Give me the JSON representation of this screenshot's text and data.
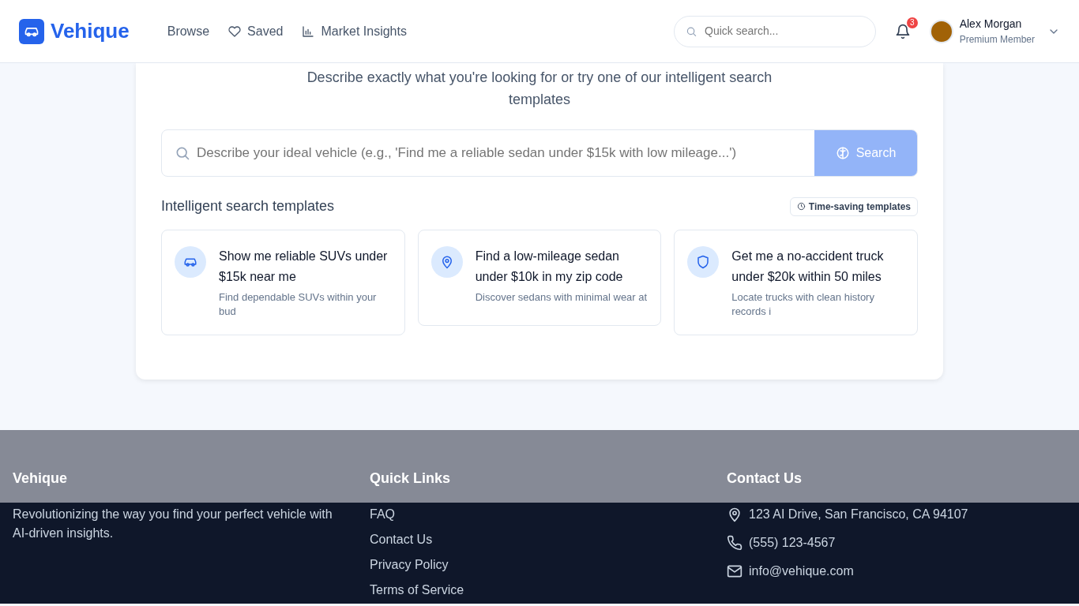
{
  "header": {
    "brand": "Vehique",
    "nav": [
      {
        "label": "Browse"
      },
      {
        "label": "Saved"
      },
      {
        "label": "Market Insights"
      }
    ],
    "search": {
      "placeholder": "Quick search..."
    },
    "notifications": {
      "count": "3"
    },
    "user": {
      "name": "Alex Morgan",
      "role": "Premium Member"
    }
  },
  "hero": {
    "subtitle": "Describe exactly what you're looking for or try one of our intelligent search templates",
    "search": {
      "placeholder": "Describe your ideal vehicle (e.g., 'Find me a reliable sedan under $15k with low mileage...')",
      "button": "Search",
      "disabled": true
    }
  },
  "templates": {
    "title": "Intelligent search templates",
    "tag": "Time-saving templates",
    "items": [
      {
        "title": "Show me reliable SUVs under $15k near me",
        "description": "Find dependable SUVs within your bud"
      },
      {
        "title": "Find a low-mileage sedan under $10k in my zip code",
        "description": "Discover sedans with minimal wear at"
      },
      {
        "title": "Get me a no-accident truck under $20k within 50 miles",
        "description": "Locate trucks with clean history records i"
      }
    ]
  },
  "footer": {
    "columns": [
      {
        "kind": "about",
        "title": "Vehique",
        "text": "Revolutionizing the way you find your perfect vehicle with AI-driven insights."
      },
      {
        "kind": "links",
        "title": "Quick Links",
        "links": [
          "FAQ",
          "Contact Us",
          "Privacy Policy",
          "Terms of Service"
        ]
      },
      {
        "kind": "contact",
        "title": "Contact Us",
        "items": [
          {
            "text": "123 AI Drive, San Francisco, CA 94107"
          },
          {
            "text": "(555) 123-4567"
          },
          {
            "text": "info@vehique.com"
          }
        ]
      }
    ]
  }
}
